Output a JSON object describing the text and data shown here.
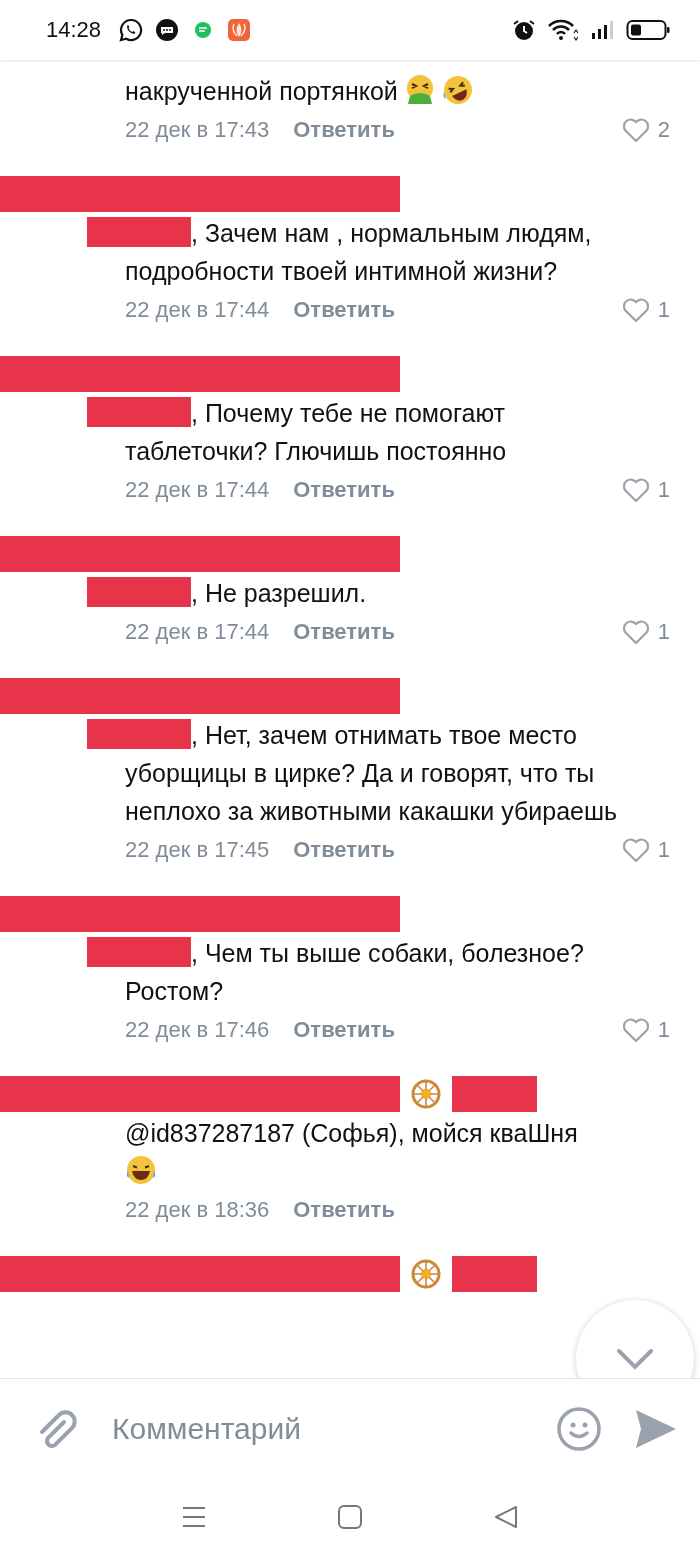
{
  "status_bar": {
    "time": "14:28"
  },
  "comments": [
    {
      "kind": "partial",
      "text": "накрученной портянкой",
      "emojis": [
        {
          "kind": "sick"
        },
        {
          "kind": "rofl"
        }
      ],
      "date": "22 дек в 17:43",
      "reply": "Ответить",
      "likes": "2"
    },
    {
      "kind": "reply",
      "text": ", Зачем нам , нормальным людям, подробности твоей интимной жизни?",
      "date": "22 дек в 17:44",
      "reply": "Ответить",
      "likes": "1"
    },
    {
      "kind": "reply",
      "text": ", Почему тебе не помогают таблеточки? Глючишь постоянно",
      "date": "22 дек в 17:44",
      "reply": "Ответить",
      "likes": "1"
    },
    {
      "kind": "reply",
      "text": ", Не разрешил.",
      "date": "22 дек в 17:44",
      "reply": "Ответить",
      "likes": "1"
    },
    {
      "kind": "reply",
      "text": ", Нет, зачем отнимать твое место уборщицы в цирке? Да и говорят, что ты неплохо за животными какашки убираешь",
      "date": "22 дек в 17:45",
      "reply": "Ответить",
      "likes": "1"
    },
    {
      "kind": "reply",
      "text": ", Чем ты выше собаки, болезное? Ростом?",
      "date": "22 дек в 17:46",
      "reply": "Ответить",
      "likes": "1"
    },
    {
      "kind": "badged",
      "text": "@id837287187 (Софья), мойся кваШня",
      "emojis": [
        {
          "kind": "laugh"
        }
      ],
      "date": "22 дек в 18:36",
      "reply": "Ответить"
    },
    {
      "kind": "badged_header"
    }
  ],
  "composer": {
    "placeholder": "Комментарий"
  }
}
